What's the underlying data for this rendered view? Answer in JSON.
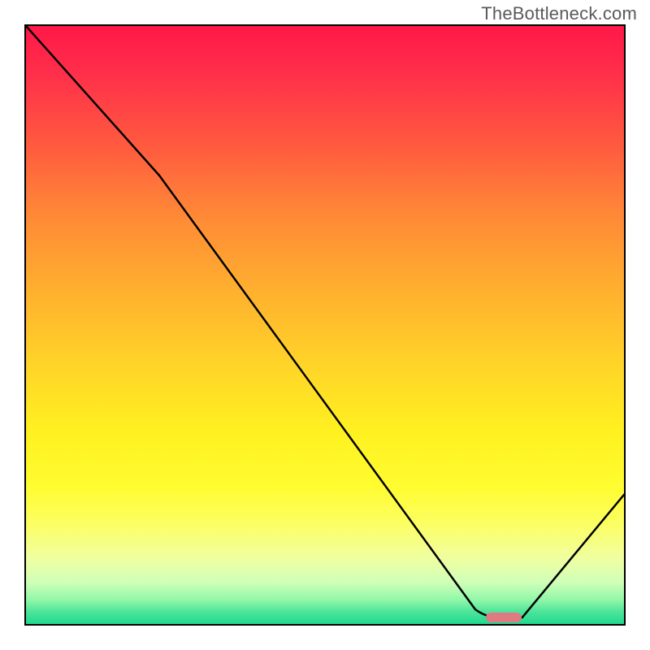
{
  "watermark": "TheBottleneck.com",
  "chart_data": {
    "type": "line",
    "title": "",
    "xlabel": "",
    "ylabel": "",
    "ylim": [
      0,
      100
    ],
    "xlim": [
      0,
      100
    ],
    "x": [
      0,
      22,
      78,
      83,
      100
    ],
    "values": [
      100,
      75,
      1,
      1,
      22
    ],
    "marker": {
      "x": 79,
      "y": 1,
      "width_pct": 6
    },
    "description": "V-shaped curve starting at upper-left, inflection near x≈22, descending to a trough around x≈78–83 at y≈1, then rising to y≈22 at right edge. Background is a vertical spectrum gradient from red (top) through orange, yellow to green (bottom)."
  }
}
